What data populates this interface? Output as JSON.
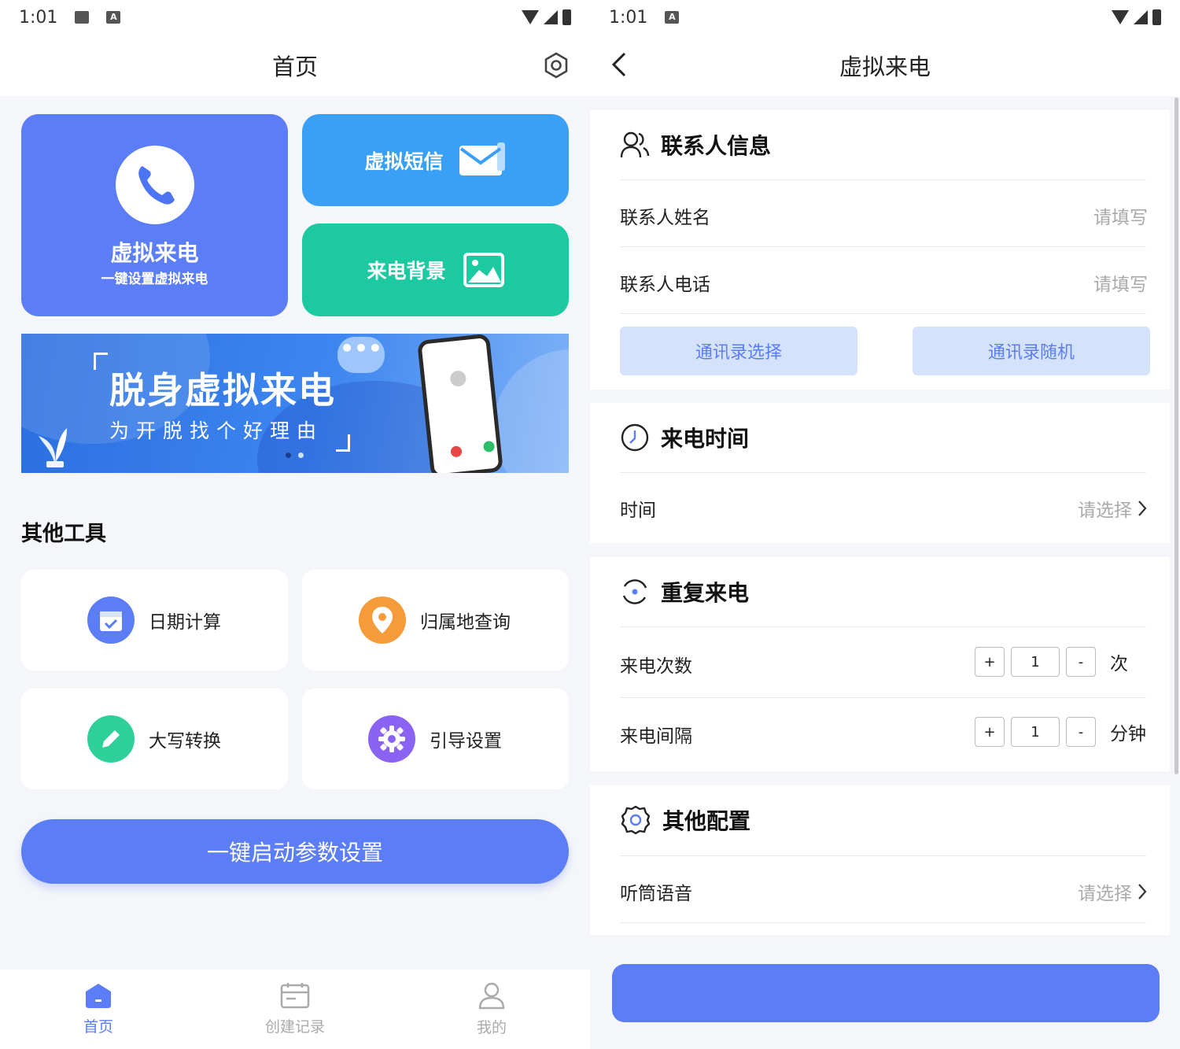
{
  "left": {
    "status": {
      "time": "1:01"
    },
    "nav": {
      "title": "首页"
    },
    "cards": {
      "call_title": "虚拟来电",
      "call_sub": "一键设置虚拟来电",
      "sms": "虚拟短信",
      "bg": "来电背景"
    },
    "banner": {
      "title": "脱身虚拟来电",
      "subtitle": "为开脱找个好理由",
      "bubble": "•••"
    },
    "tools_title": "其他工具",
    "tools": [
      {
        "label": "日期计算",
        "icon": "calendar-icon",
        "color": "#5b7df5"
      },
      {
        "label": "归属地查询",
        "icon": "location-pin-icon",
        "color": "#f59b3a"
      },
      {
        "label": "大写转换",
        "icon": "pencil-icon",
        "color": "#2fcf9a"
      },
      {
        "label": "引导设置",
        "icon": "gear-icon",
        "color": "#8a63f3"
      }
    ],
    "cta": "一键启动参数设置",
    "tabs": [
      {
        "label": "首页",
        "icon": "home-icon"
      },
      {
        "label": "创建记录",
        "icon": "record-icon"
      },
      {
        "label": "我的",
        "icon": "user-icon"
      }
    ],
    "accent": "#5b7df5"
  },
  "right": {
    "status": {
      "time": "1:01"
    },
    "nav": {
      "title": "虚拟来电"
    },
    "contact": {
      "title": "联系人信息",
      "name_label": "联系人姓名",
      "name_placeholder": "请填写",
      "phone_label": "联系人电话",
      "phone_placeholder": "请填写",
      "btn_contacts": "通讯录选择",
      "btn_random": "通讯录随机"
    },
    "time": {
      "title": "来电时间",
      "label": "时间",
      "placeholder": "请选择"
    },
    "repeat": {
      "title": "重复来电",
      "count_label": "来电次数",
      "count_value": "1",
      "count_unit": "次",
      "interval_label": "来电间隔",
      "interval_value": "1",
      "interval_unit": "分钟",
      "plus": "+",
      "minus": "-"
    },
    "other": {
      "title": "其他配置",
      "voice_label": "听筒语音",
      "voice_placeholder": "请选择"
    }
  }
}
